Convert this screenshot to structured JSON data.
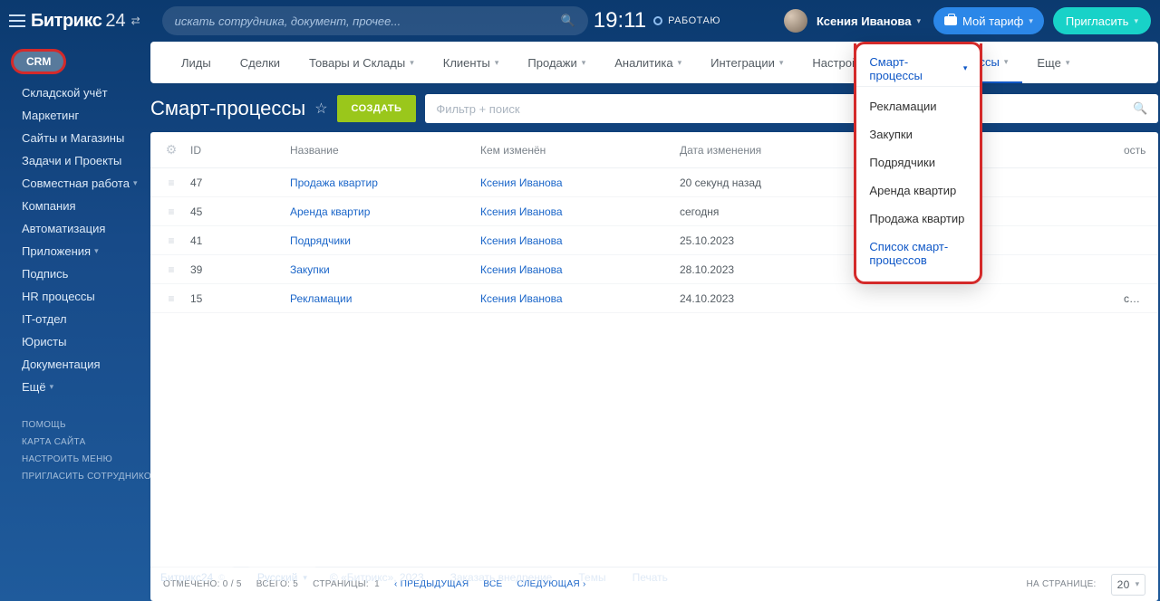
{
  "header": {
    "logo1": "Битрикс",
    "logo2": "24",
    "search_placeholder": "искать сотрудника, документ, прочее...",
    "clock": "19:11",
    "status": "РАБОТАЮ",
    "user": "Ксения Иванова",
    "tariff_label": "Мой тариф",
    "invite_label": "Пригласить"
  },
  "sidebar": {
    "badge": "CRM",
    "items": [
      {
        "label": "Складской учёт",
        "chev": false
      },
      {
        "label": "Маркетинг",
        "chev": false
      },
      {
        "label": "Сайты и Магазины",
        "chev": false
      },
      {
        "label": "Задачи и Проекты",
        "chev": false
      },
      {
        "label": "Совместная работа",
        "chev": true
      },
      {
        "label": "Компания",
        "chev": false
      },
      {
        "label": "Автоматизация",
        "chev": false
      },
      {
        "label": "Приложения",
        "chev": true
      },
      {
        "label": "Подпись",
        "chev": false
      },
      {
        "label": "HR процессы",
        "chev": false
      },
      {
        "label": "IT-отдел",
        "chev": false
      },
      {
        "label": "Юристы",
        "chev": false
      },
      {
        "label": "Документация",
        "chev": false
      },
      {
        "label": "Ещё",
        "chev": true
      }
    ],
    "sub": [
      "ПОМОЩЬ",
      "КАРТА САЙТА",
      "НАСТРОИТЬ МЕНЮ",
      "ПРИГЛАСИТЬ СОТРУДНИКОВ"
    ]
  },
  "tabs": [
    {
      "label": "Лиды",
      "chev": false
    },
    {
      "label": "Сделки",
      "chev": false
    },
    {
      "label": "Товары и Склады",
      "chev": true
    },
    {
      "label": "Клиенты",
      "chev": true
    },
    {
      "label": "Продажи",
      "chev": true
    },
    {
      "label": "Аналитика",
      "chev": true
    },
    {
      "label": "Интеграции",
      "chev": true
    },
    {
      "label": "Настройки",
      "chev": true
    },
    {
      "label": "Смарт-процессы",
      "chev": true,
      "active": true
    },
    {
      "label": "Еще",
      "chev": true
    }
  ],
  "page": {
    "title": "Смарт-процессы",
    "create": "СОЗДАТЬ",
    "filter_placeholder": "Фильтр + поиск"
  },
  "table": {
    "headers": [
      "ID",
      "Название",
      "Кем изменён",
      "Дата изменения",
      "",
      "ость"
    ],
    "rows": [
      {
        "id": "47",
        "name": "Продажа квартир",
        "by": "Ксения Иванова",
        "date": "20 секунд назад",
        "extra": ""
      },
      {
        "id": "45",
        "name": "Аренда квартир",
        "by": "Ксения Иванова",
        "date": "сегодня",
        "extra": ""
      },
      {
        "id": "41",
        "name": "Подрядчики",
        "by": "Ксения Иванова",
        "date": "25.10.2023",
        "extra": ""
      },
      {
        "id": "39",
        "name": "Закупки",
        "by": "Ксения Иванова",
        "date": "28.10.2023",
        "extra": ""
      },
      {
        "id": "15",
        "name": "Рекламации",
        "by": "Ксения Иванова",
        "date": "24.10.2023",
        "extra": "сегодня"
      }
    ]
  },
  "pager": {
    "checked": "ОТМЕЧЕНО: 0 / 5",
    "total": "ВСЕГО: 5",
    "pages": "СТРАНИЦЫ:",
    "page_no": "1",
    "prev": "ПРЕДЫДУЩАЯ",
    "all": "ВСЕ",
    "next": "СЛЕДУЮЩАЯ",
    "per_page": "НА СТРАНИЦЕ:",
    "per_value": "20"
  },
  "dropdown": {
    "top_tab": "Смарт-процессы",
    "items": [
      "Рекламации",
      "Закупки",
      "Подрядчики",
      "Аренда квартир",
      "Продажа квартир"
    ],
    "accent": "Список смарт-процессов"
  },
  "footer": {
    "brand": "Битрикс24",
    "lang": "Русский",
    "copyright": "© «Битрикс», 2023",
    "links": [
      "Заказать внедрение",
      "Темы",
      "Печать"
    ]
  }
}
